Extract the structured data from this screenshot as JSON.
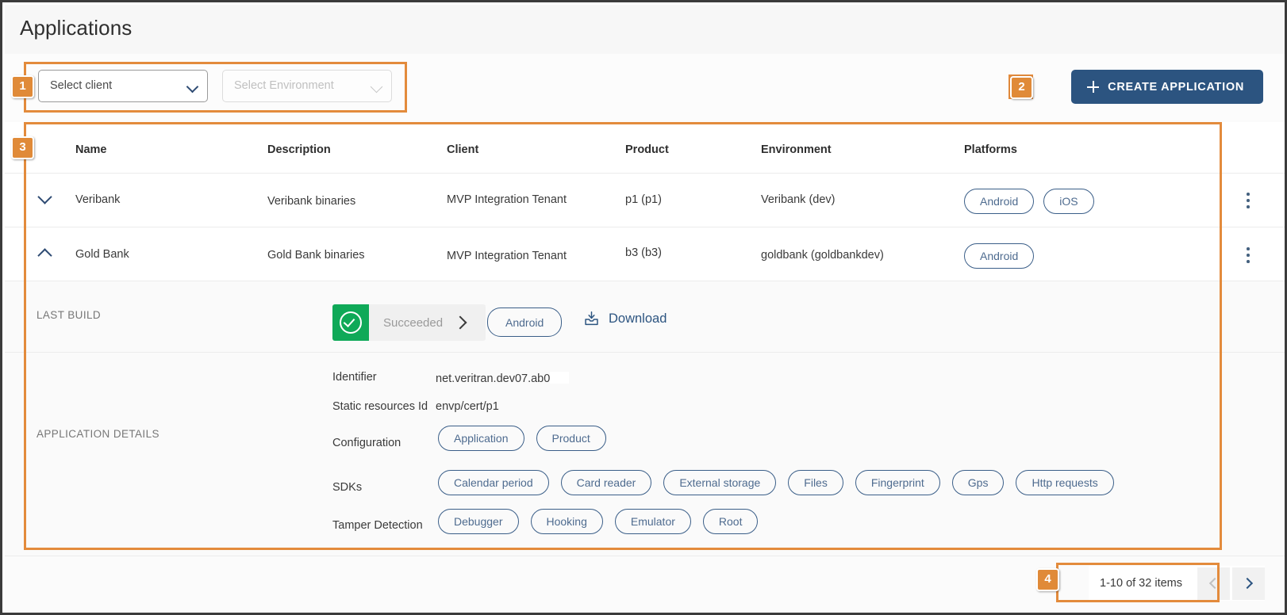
{
  "header": {
    "title": "Applications"
  },
  "filters": {
    "client_select": {
      "value": "Select client",
      "icon": "chevron-down-icon"
    },
    "environment_select": {
      "placeholder": "Select Environment",
      "icon": "chevron-down-icon"
    }
  },
  "actions": {
    "create_label": "CREATE APPLICATION",
    "create_icon": "plus-icon"
  },
  "table": {
    "columns": [
      "Name",
      "Description",
      "Client",
      "Product",
      "Environment",
      "Platforms"
    ],
    "rows": [
      {
        "name": "Veribank",
        "description": "Veribank binaries",
        "client": "MVP Integration Tenant",
        "product": "p1 (p1)",
        "environment": "Veribank (dev)",
        "platforms": [
          "Android",
          "iOS"
        ],
        "expanded": false,
        "chevron": "chevron-down-icon",
        "menu_icon": "kebab-menu-icon"
      },
      {
        "name": "Gold Bank",
        "description": "Gold Bank binaries",
        "client": "MVP Integration Tenant",
        "product": "b3 (b3)",
        "environment": "goldbank (goldbankdev)",
        "platforms": [
          "Android"
        ],
        "expanded": true,
        "chevron": "chevron-up-icon",
        "menu_icon": "kebab-menu-icon"
      }
    ]
  },
  "detail": {
    "last_build_label": "LAST BUILD",
    "build": {
      "status": "Succeeded",
      "status_icon": "check-circle-icon",
      "status_color": "#0fa958",
      "arrow_icon": "chevron-right-icon",
      "platform": "Android",
      "download_label": "Download",
      "download_icon": "download-icon"
    },
    "application_details_label": "APPLICATION DETAILS",
    "fields": [
      {
        "label": "Identifier",
        "value": "net.veritran.dev07.ab0",
        "redacted": true
      },
      {
        "label": "Static resources Id",
        "value": "envp/cert/p1",
        "redacted": false
      }
    ],
    "configuration": {
      "label": "Configuration",
      "chips": [
        "Application",
        "Product"
      ]
    },
    "sdks": {
      "label": "SDKs",
      "chips": [
        "Calendar period",
        "Card reader",
        "External storage",
        "Files",
        "Fingerprint",
        "Gps",
        "Http requests"
      ]
    },
    "tamper_detection": {
      "label": "Tamper Detection",
      "chips": [
        "Debugger",
        "Hooking",
        "Emulator",
        "Root"
      ]
    }
  },
  "pagination": {
    "summary": "1-10 of 32 items",
    "prev_icon": "chevron-left-icon",
    "next_icon": "chevron-right-icon"
  },
  "annotations": [
    {
      "number": "1"
    },
    {
      "number": "2"
    },
    {
      "number": "3"
    },
    {
      "number": "4"
    }
  ],
  "colors": {
    "accent_blue": "#2c5480",
    "annotation_orange": "#e38b3c",
    "success_green": "#0fa958"
  }
}
